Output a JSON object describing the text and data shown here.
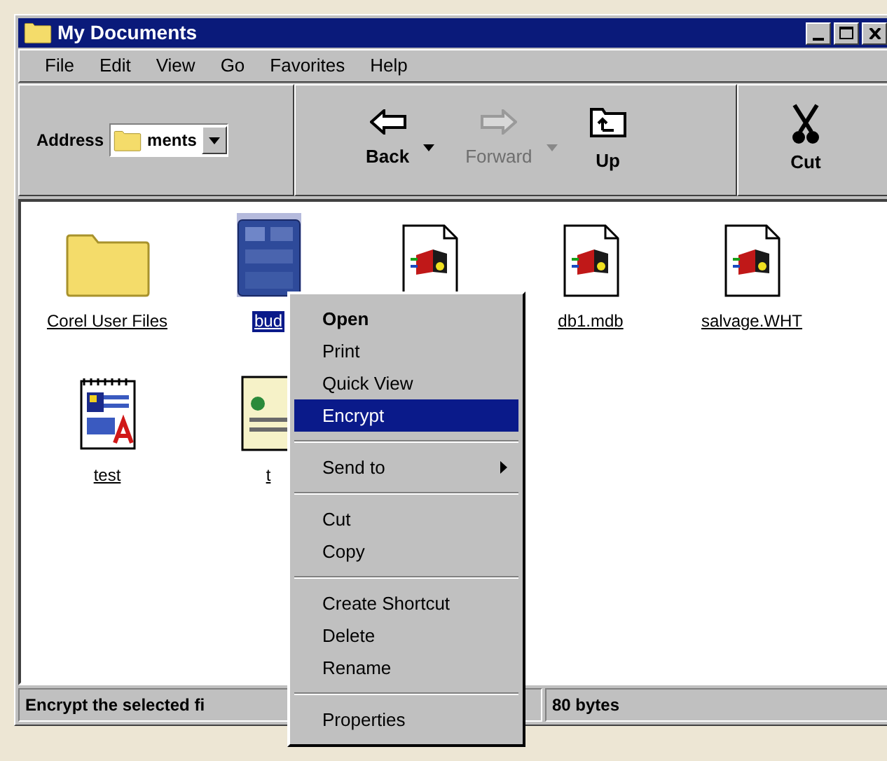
{
  "window": {
    "title": "My Documents"
  },
  "menu_bar": [
    {
      "label": "File"
    },
    {
      "label": "Edit"
    },
    {
      "label": "View"
    },
    {
      "label": "Go"
    },
    {
      "label": "Favorites"
    },
    {
      "label": "Help"
    }
  ],
  "address_bar": {
    "label": "Address",
    "value": "ments"
  },
  "toolbar": [
    {
      "kind": "back",
      "label": "Back",
      "disabled": false,
      "dropdown": true
    },
    {
      "kind": "forward",
      "label": "Forward",
      "disabled": true,
      "dropdown": true
    },
    {
      "kind": "up",
      "label": "Up",
      "disabled": false,
      "dropdown": false
    }
  ],
  "toolbar_extra": {
    "kind": "cut",
    "label": "Cut"
  },
  "files": [
    {
      "kind": "folder",
      "label": "Corel User Files",
      "selected": false
    },
    {
      "kind": "image",
      "label": "bud",
      "selected": true
    },
    {
      "kind": "database",
      "selected": false
    },
    {
      "kind": "database",
      "label": "db1.mdb",
      "selected": false
    },
    {
      "kind": "database",
      "label": "salvage.WHT",
      "selected": false
    },
    {
      "kind": "text",
      "label": "test",
      "selected": false
    },
    {
      "kind": "sheet",
      "label": "t",
      "selected": false
    }
  ],
  "status_bar": {
    "message": "Encrypt the selected fi",
    "size": "80 bytes"
  },
  "context_menu": [
    {
      "kind": "item",
      "label": "Open",
      "default": true,
      "selected": false
    },
    {
      "kind": "item",
      "label": "Print",
      "default": false,
      "selected": false
    },
    {
      "kind": "item",
      "label": "Quick View",
      "default": false,
      "selected": false
    },
    {
      "kind": "item",
      "label": "Encrypt",
      "default": false,
      "selected": true
    },
    {
      "kind": "separator"
    },
    {
      "kind": "submenu",
      "label": "Send to",
      "default": false,
      "selected": false
    },
    {
      "kind": "separator"
    },
    {
      "kind": "item",
      "label": "Cut",
      "default": false,
      "selected": false
    },
    {
      "kind": "item",
      "label": "Copy",
      "default": false,
      "selected": false
    },
    {
      "kind": "separator"
    },
    {
      "kind": "item",
      "label": "Create Shortcut",
      "default": false,
      "selected": false
    },
    {
      "kind": "item",
      "label": "Delete",
      "default": false,
      "selected": false
    },
    {
      "kind": "item",
      "label": "Rename",
      "default": false,
      "selected": false
    },
    {
      "kind": "separator"
    },
    {
      "kind": "item",
      "label": "Properties",
      "default": false,
      "selected": false
    }
  ]
}
